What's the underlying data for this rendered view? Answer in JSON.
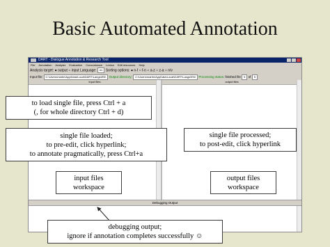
{
  "slide": {
    "title": "Basic Automated Annotation"
  },
  "window": {
    "title": "DART - Dialogue Annotation & Research Tool",
    "menu": [
      "File",
      "Annotation",
      "Analysis",
      "Evaluation",
      "Concordance",
      "Lexica",
      "Edit resources",
      "Help"
    ],
    "options": {
      "analysis_target_label": "Analysis target:",
      "output_label": "output",
      "input_label": "input",
      "language_label": "Language:",
      "language_value": "en",
      "sorting_label": "Sorting options:",
      "sort_values": [
        "n-f",
        "f-n",
        "a-z",
        "z-a",
        "n/v"
      ]
    },
    "files": {
      "input_label": "Input file:",
      "input_path": "C:\\Users\\martin\\AppData\\Local\\DART\\Langs\\EN\\",
      "output_label": "Output directory:",
      "output_path": "C:\\Users\\martin\\AppData\\Local\\DART\\Langs\\EN\\",
      "status_label": "Processing status:",
      "status_value": "finished",
      "file_label": "file",
      "file_num": "5",
      "of_label": "of",
      "file_total": "5"
    },
    "panes": {
      "input_header": "input files",
      "output_header": "output files"
    },
    "debug_header": "Debugging Output"
  },
  "callouts": {
    "load_line1": "to load single file, press Ctrl + a",
    "load_line2": "(, for whole directory Ctrl + d)",
    "loaded_line1": "single file loaded;",
    "loaded_line2": "to pre-edit, click hyperlink;",
    "loaded_line3": "to annotate pragmatically, press Ctrl+a",
    "processed_line1": "single file processed;",
    "processed_line2": "to post-edit, click hyperlink",
    "input_ws_line1": "input files",
    "input_ws_line2": "workspace",
    "output_ws_line1": "output files",
    "output_ws_line2": "workspace",
    "debug_line1": "debugging output;",
    "debug_line2": "ignore if annotation completes successfully ☺"
  }
}
